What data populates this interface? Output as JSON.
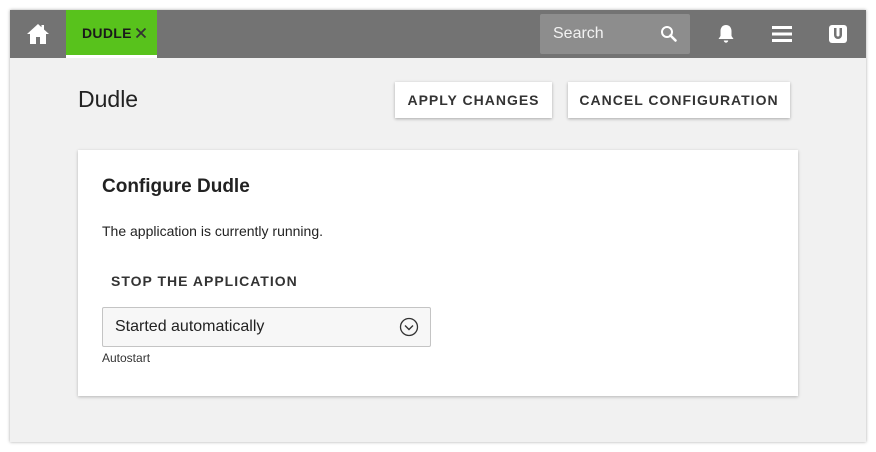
{
  "topbar": {
    "home_icon": "home-icon",
    "tab": {
      "label": "DUDLE",
      "close_icon": "close-icon",
      "color": "#58c21c"
    },
    "search": {
      "placeholder": "Search",
      "icon": "search-icon"
    },
    "icons": [
      "bell-icon",
      "menu-icon",
      "user-icon"
    ]
  },
  "page": {
    "title": "Dudle",
    "apply_label": "APPLY CHANGES",
    "cancel_label": "CANCEL CONFIGURATION"
  },
  "card": {
    "title": "Configure Dudle",
    "status_text": "The application is currently running.",
    "stop_label": "STOP THE APPLICATION",
    "select": {
      "value": "Started automatically",
      "caption": "Autostart",
      "icon": "chevron-down-icon"
    }
  }
}
